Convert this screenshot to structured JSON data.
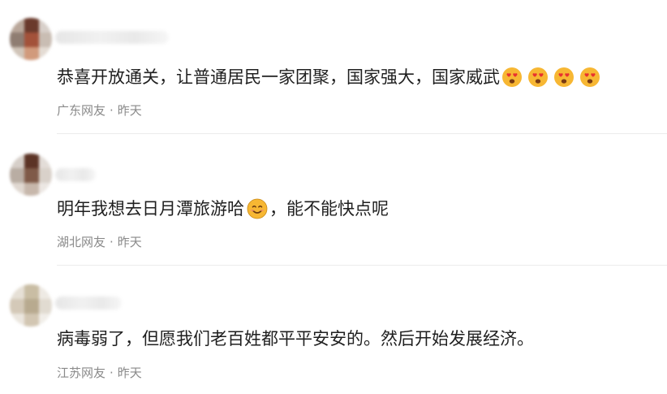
{
  "comments": [
    {
      "text": "恭喜开放通关，让普通居民一家团聚，国家强大，国家威武",
      "emojis": [
        "heart-eyes-emoji",
        "heart-eyes-emoji",
        "heart-eyes-emoji",
        "heart-eyes-emoji"
      ],
      "location": "广东网友",
      "separator": "·",
      "time": "昨天"
    },
    {
      "text_before": "明年我想去日月潭旅游哈",
      "inline_emoji": "smiling-face-emoji",
      "text_after": "，能不能快点呢",
      "location": "湖北网友",
      "separator": "·",
      "time": "昨天"
    },
    {
      "text": "病毒弱了，但愿我们老百姓都平平安安的。然后开始发展经济。",
      "location": "江苏网友",
      "separator": "·",
      "time": "昨天"
    }
  ],
  "colors": {
    "text": "#1f1f1f",
    "meta": "#8a8a8a",
    "divider": "#ececec",
    "emoji_face": "#f7b733",
    "emoji_heart": "#e8322f"
  }
}
